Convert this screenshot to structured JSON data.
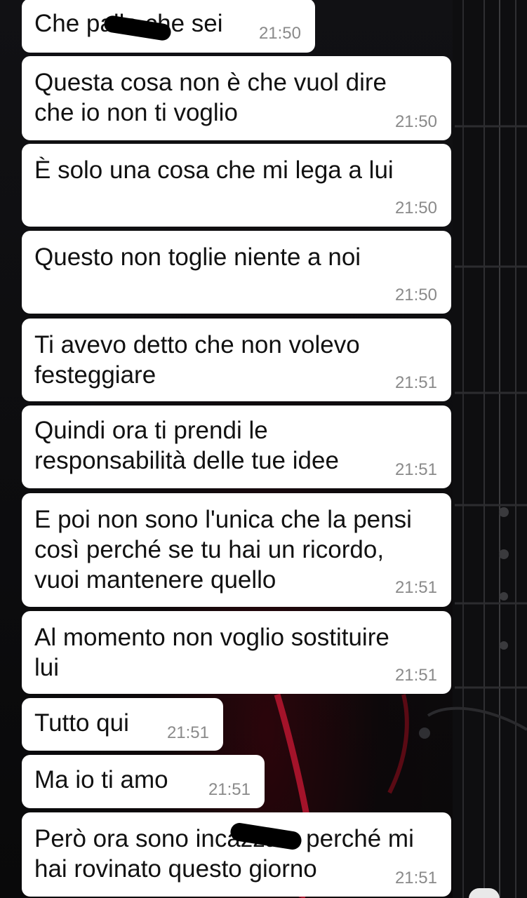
{
  "messages": [
    {
      "text": "Che palle che sei",
      "time": "21:50"
    },
    {
      "text": "Questa cosa non è che vuol dire\nche io non ti voglio",
      "time": "21:50"
    },
    {
      "text": "È solo una cosa che mi lega a lui",
      "time": "21:50"
    },
    {
      "text": "Questo non toglie niente a noi",
      "time": "21:50"
    },
    {
      "text": "Ti avevo detto che non volevo\nfesteggiare",
      "time": "21:51"
    },
    {
      "text": "Quindi ora ti prendi le\nresponsabilità delle tue idee",
      "time": "21:51"
    },
    {
      "text": "E poi non sono l'unica che la pensi\ncosì perché se tu hai un ricordo,\nvuoi mantenere quello",
      "time": "21:51"
    },
    {
      "text": "Al momento non voglio sostituire\nlui",
      "time": "21:51"
    },
    {
      "text": "Tutto qui",
      "time": "21:51"
    },
    {
      "text": "Ma io ti amo",
      "time": "21:51"
    },
    {
      "text": "Però ora sono incazzata perché mi\nhai rovinato questo giorno",
      "time": "21:51"
    }
  ],
  "colors": {
    "bubble": "#ffffff",
    "text": "#111111",
    "timestamp": "#8a8a8a",
    "wallpaper": "#0b0b0c"
  }
}
